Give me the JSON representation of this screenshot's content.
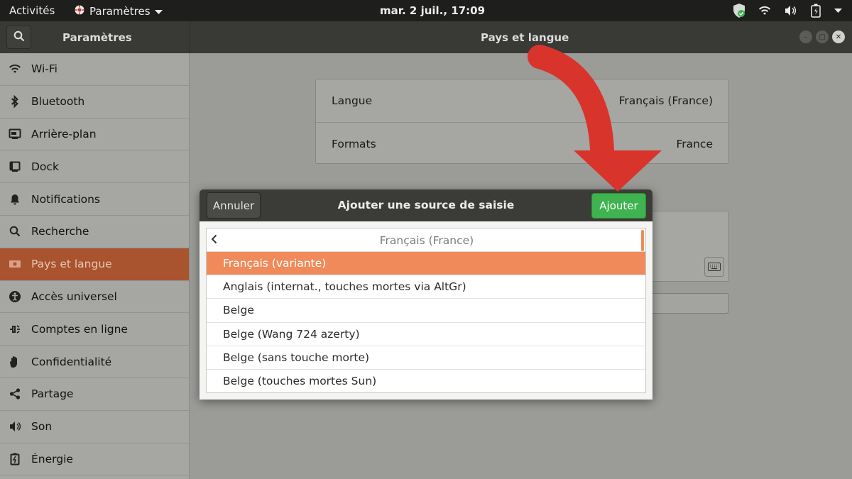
{
  "topbar": {
    "activities": "Activités",
    "app_menu": "Paramètres",
    "clock": "mar.  2 juil., 17:09",
    "tray_icons": [
      "shield-icon",
      "wifi-icon",
      "volume-icon",
      "battery-icon",
      "chevron-down-icon"
    ]
  },
  "headerbar": {
    "left_title": "Paramètres",
    "title": "Pays et langue"
  },
  "sidebar": {
    "items": [
      {
        "label": "Wi-Fi",
        "icon": "wifi-icon"
      },
      {
        "label": "Bluetooth",
        "icon": "bluetooth-icon"
      },
      {
        "label": "Arrière-plan",
        "icon": "background-icon"
      },
      {
        "label": "Dock",
        "icon": "dock-icon"
      },
      {
        "label": "Notifications",
        "icon": "bell-icon"
      },
      {
        "label": "Recherche",
        "icon": "search-icon"
      },
      {
        "label": "Pays et langue",
        "icon": "flag-icon",
        "active": true
      },
      {
        "label": "Accès universel",
        "icon": "accessibility-icon"
      },
      {
        "label": "Comptes en ligne",
        "icon": "online-accounts-icon"
      },
      {
        "label": "Confidentialité",
        "icon": "hand-icon"
      },
      {
        "label": "Partage",
        "icon": "share-icon"
      },
      {
        "label": "Son",
        "icon": "speaker-icon"
      },
      {
        "label": "Énergie",
        "icon": "power-icon"
      }
    ]
  },
  "main": {
    "rows": [
      {
        "label": "Langue",
        "value": "Français (France)"
      },
      {
        "label": "Formats",
        "value": "France"
      }
    ]
  },
  "dialog": {
    "cancel_label": "Annuler",
    "title": "Ajouter une source de saisie",
    "add_label": "Ajouter",
    "list_header": "Français (France)",
    "items": [
      {
        "label": "Français (variante)",
        "selected": true
      },
      {
        "label": "Anglais (internat., touches mortes via AltGr)"
      },
      {
        "label": "Belge"
      },
      {
        "label": "Belge (Wang 724 azerty)"
      },
      {
        "label": "Belge (sans touche morte)"
      },
      {
        "label": "Belge (touches mortes Sun)"
      }
    ]
  },
  "colors": {
    "accent": "#f08a5a",
    "add_button": "#3eb34f",
    "arrow": "#d9342b",
    "sidebar_active": "#a9532f"
  }
}
